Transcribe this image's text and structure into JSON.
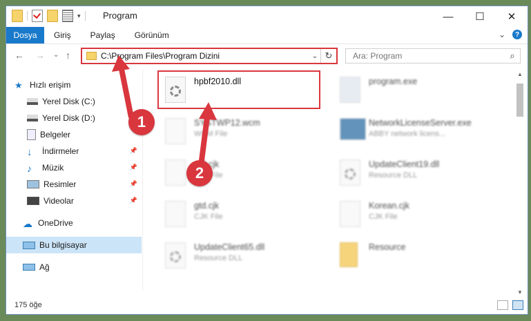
{
  "window": {
    "title": "Program",
    "controls": {
      "minimize": "—",
      "maximize": "☐",
      "close": "✕"
    }
  },
  "ribbon": {
    "tabs": [
      "Dosya",
      "Giriş",
      "Paylaş",
      "Görünüm"
    ],
    "help": "?",
    "expand": "⌄"
  },
  "nav": {
    "back": "←",
    "forward": "→",
    "recent": "⌄",
    "up": "↑"
  },
  "address": {
    "path": "C:\\Program Files\\Program Dizini",
    "dropdown": "⌄",
    "refresh": "↻"
  },
  "search": {
    "placeholder": "Ara: Program",
    "icon": "⌕"
  },
  "sidebar": {
    "items": [
      {
        "label": "Hızlı erişim",
        "icon": "star-icon"
      },
      {
        "label": "Yerel Disk (C:)",
        "icon": "drive-icon"
      },
      {
        "label": "Yerel Disk (D:)",
        "icon": "drive-icon"
      },
      {
        "label": "Belgeler",
        "icon": "documents-icon"
      },
      {
        "label": "İndirmeler",
        "icon": "download-icon"
      },
      {
        "label": "Müzik",
        "icon": "music-icon"
      },
      {
        "label": "Resimler",
        "icon": "pictures-icon"
      },
      {
        "label": "Videolar",
        "icon": "video-icon"
      },
      {
        "label": "OneDrive",
        "icon": "cloud-icon"
      },
      {
        "label": "Bu bilgisayar",
        "icon": "computer-icon"
      },
      {
        "label": "Ağ",
        "icon": "network-icon"
      }
    ]
  },
  "files": [
    {
      "name": "hpbf2010.dll",
      "type": ""
    },
    {
      "name": "program.exe",
      "type": ""
    },
    {
      "name": "SYSTWP12.wcm",
      "type": "WCM File"
    },
    {
      "name": "NetworkLicenseServer.exe",
      "type": "ABBY network licens..."
    },
    {
      "name": "gtd.cjk",
      "type": "CJK File"
    },
    {
      "name": "UpdateClient19.dll",
      "type": "Resource DLL"
    },
    {
      "name": "gtd.cjk",
      "type": "CJK File"
    },
    {
      "name": "Korean.cjk",
      "type": "CJK File"
    },
    {
      "name": "UpdateClient65.dll",
      "type": "Resource DLL"
    },
    {
      "name": "Resource",
      "type": ""
    }
  ],
  "annotations": {
    "step1": "1",
    "step2": "2",
    "accent": "#d9363e"
  },
  "status": {
    "count": "175 öğe"
  }
}
